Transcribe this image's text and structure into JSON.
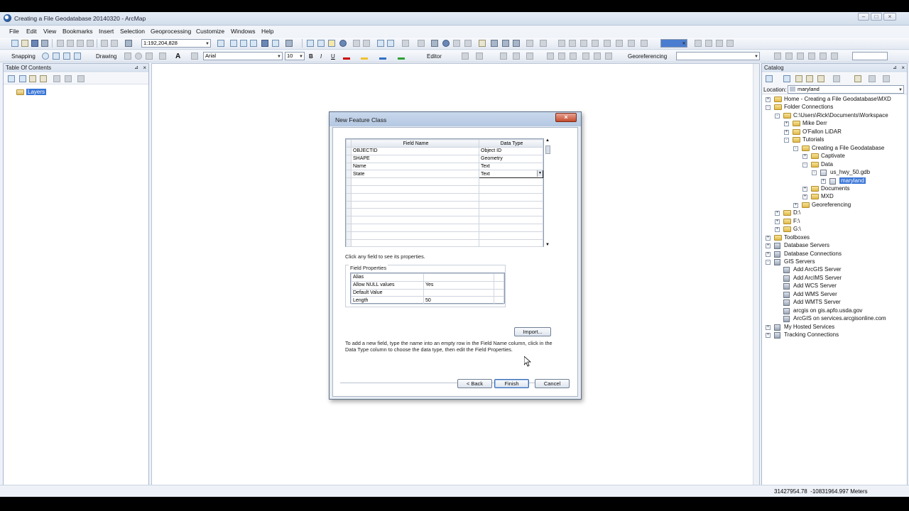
{
  "window": {
    "title": "Creating a File Geodatabase 20140320 - ArcMap"
  },
  "menubar": [
    "File",
    "Edit",
    "View",
    "Bookmarks",
    "Insert",
    "Selection",
    "Geoprocessing",
    "Customize",
    "Windows",
    "Help"
  ],
  "toolbar": {
    "scale": "1:192,204,828",
    "snapping_label": "Snapping",
    "drawing_label": "Drawing",
    "font_name": "Arial",
    "font_size": "10",
    "bold": "B",
    "italic": "I",
    "underline": "U",
    "editor_label": "Editor",
    "georeferencing_label": "Georeferencing"
  },
  "toc": {
    "title": "Table Of Contents",
    "layers_label": "Layers"
  },
  "catalog": {
    "title": "Catalog",
    "location_label": "Location:",
    "location_value": "maryland",
    "tree": [
      {
        "label": "Home - Creating a File Geodatabase\\MXD",
        "level": 0,
        "exp": "+",
        "icon": "folder"
      },
      {
        "label": "Folder Connections",
        "level": 0,
        "exp": "-",
        "icon": "folder"
      },
      {
        "label": "C:\\Users\\Rick\\Documents\\Workspace",
        "level": 1,
        "exp": "-",
        "icon": "folder"
      },
      {
        "label": "Mike Derr",
        "level": 2,
        "exp": "+",
        "icon": "folder"
      },
      {
        "label": "O'Fallon LiDAR",
        "level": 2,
        "exp": "+",
        "icon": "folder"
      },
      {
        "label": "Tutorials",
        "level": 2,
        "exp": "-",
        "icon": "folder"
      },
      {
        "label": "Creating a File Geodatabase",
        "level": 3,
        "exp": "-",
        "icon": "folder"
      },
      {
        "label": "Captivate",
        "level": 4,
        "exp": "+",
        "icon": "folder"
      },
      {
        "label": "Data",
        "level": 4,
        "exp": "-",
        "icon": "folder"
      },
      {
        "label": "us_hwy_50.gdb",
        "level": 5,
        "exp": "-",
        "icon": "gdb"
      },
      {
        "label": "maryland",
        "level": 6,
        "exp": "+",
        "icon": "dataset",
        "selected": true
      },
      {
        "label": "Documents",
        "level": 4,
        "exp": "+",
        "icon": "folder"
      },
      {
        "label": "MXD",
        "level": 4,
        "exp": "+",
        "icon": "folder"
      },
      {
        "label": "Georeferencing",
        "level": 3,
        "exp": "+",
        "icon": "folder"
      },
      {
        "label": "D:\\",
        "level": 1,
        "exp": "+",
        "icon": "folder"
      },
      {
        "label": "F:\\",
        "level": 1,
        "exp": "+",
        "icon": "folder"
      },
      {
        "label": "G:\\",
        "level": 1,
        "exp": "+",
        "icon": "folder"
      },
      {
        "label": "Toolboxes",
        "level": 0,
        "exp": "+",
        "icon": "folder"
      },
      {
        "label": "Database Servers",
        "level": 0,
        "exp": "+",
        "icon": "server"
      },
      {
        "label": "Database Connections",
        "level": 0,
        "exp": "+",
        "icon": "server"
      },
      {
        "label": "GIS Servers",
        "level": 0,
        "exp": "-",
        "icon": "server"
      },
      {
        "label": "Add ArcGIS Server",
        "level": 1,
        "exp": "",
        "icon": "server"
      },
      {
        "label": "Add ArcIMS Server",
        "level": 1,
        "exp": "",
        "icon": "server"
      },
      {
        "label": "Add WCS Server",
        "level": 1,
        "exp": "",
        "icon": "server"
      },
      {
        "label": "Add WMS Server",
        "level": 1,
        "exp": "",
        "icon": "server"
      },
      {
        "label": "Add WMTS Server",
        "level": 1,
        "exp": "",
        "icon": "server"
      },
      {
        "label": "arcgis on gis.apfo.usda.gov",
        "level": 1,
        "exp": "",
        "icon": "server"
      },
      {
        "label": "ArcGIS on services.arcgisonline.com",
        "level": 1,
        "exp": "",
        "icon": "server"
      },
      {
        "label": "My Hosted Services",
        "level": 0,
        "exp": "+",
        "icon": "server"
      },
      {
        "label": "Tracking Connections",
        "level": 0,
        "exp": "+",
        "icon": "server"
      }
    ]
  },
  "status": {
    "coords": "31427954.78  -10831964.997 Meters"
  },
  "dialog": {
    "title": "New Feature Class",
    "grid_headers": {
      "field_name": "Field Name",
      "data_type": "Data Type"
    },
    "fields": [
      {
        "name": "OBJECTID",
        "type": "Object ID"
      },
      {
        "name": "SHAPE",
        "type": "Geometry"
      },
      {
        "name": "Name",
        "type": "Text"
      },
      {
        "name": "State",
        "type": "Text"
      },
      {
        "name": "",
        "type": ""
      },
      {
        "name": "",
        "type": ""
      },
      {
        "name": "",
        "type": ""
      },
      {
        "name": "",
        "type": ""
      },
      {
        "name": "",
        "type": ""
      },
      {
        "name": "",
        "type": ""
      },
      {
        "name": "",
        "type": ""
      },
      {
        "name": "",
        "type": ""
      },
      {
        "name": "",
        "type": ""
      }
    ],
    "hint": "Click any field to see its properties.",
    "field_properties_label": "Field Properties",
    "properties": [
      {
        "key": "Alias",
        "value": ""
      },
      {
        "key": "Allow NULL values",
        "value": "Yes"
      },
      {
        "key": "Default Value",
        "value": ""
      },
      {
        "key": "Length",
        "value": "50"
      }
    ],
    "import_label": "Import...",
    "instructions": "To add a new field, type the name into an empty row in the Field Name column, click in the Data Type column to choose the data type, then edit the Field Properties.",
    "back_label": "< Back",
    "finish_label": "Finish",
    "cancel_label": "Cancel"
  }
}
